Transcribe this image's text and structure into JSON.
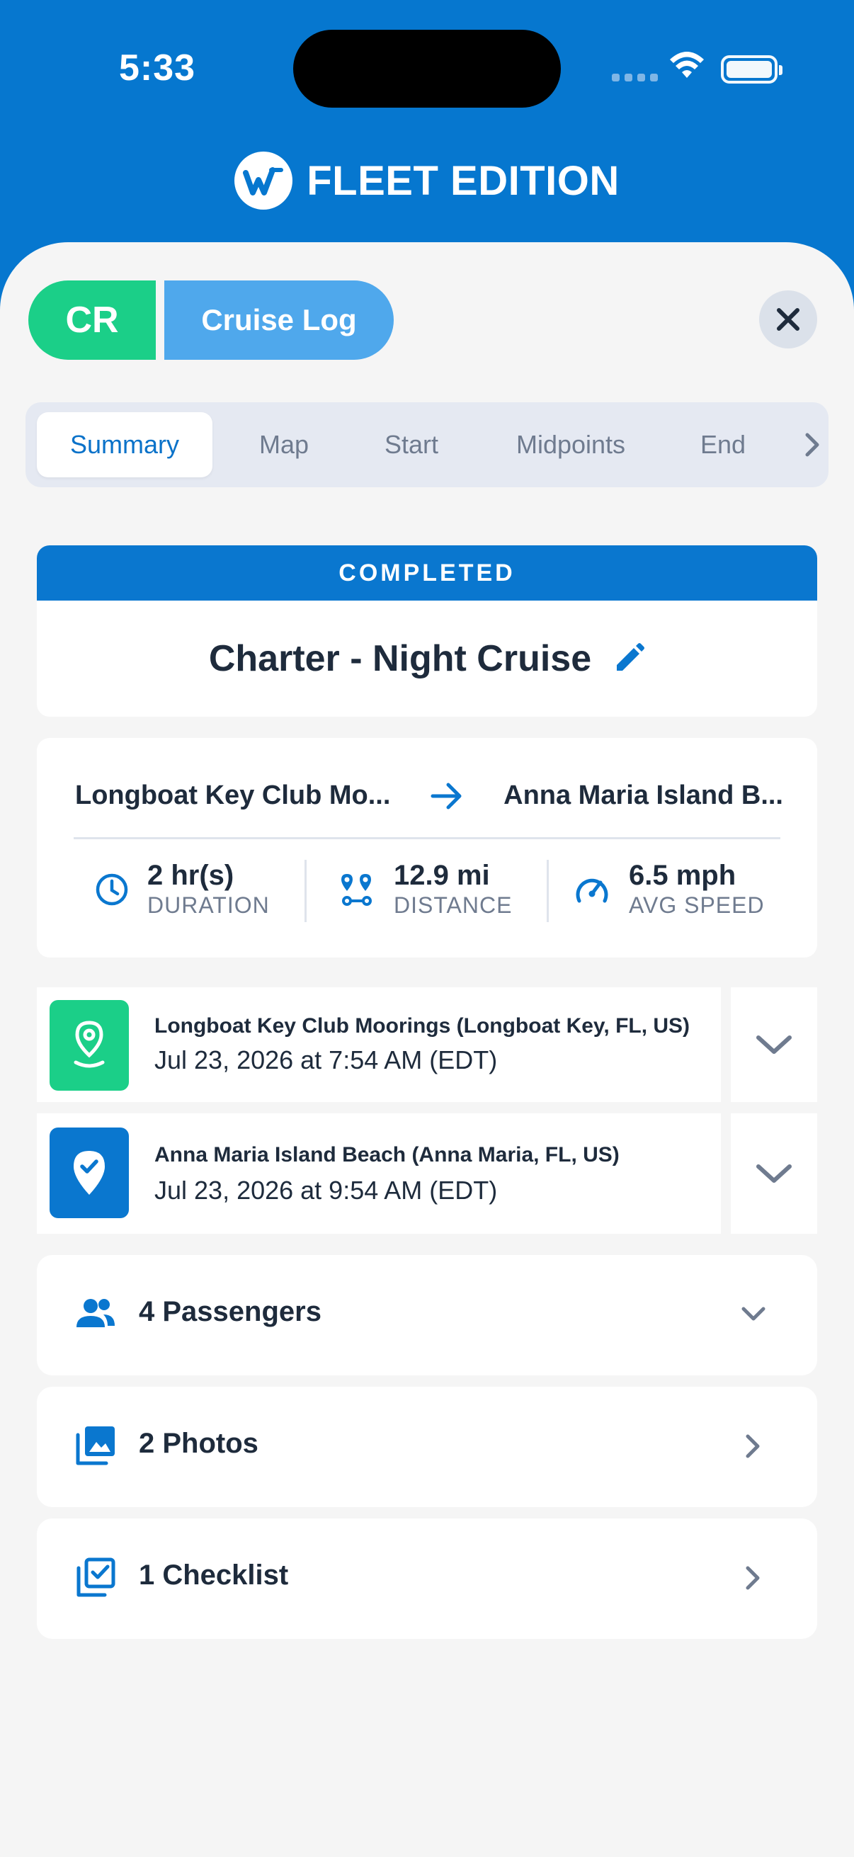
{
  "status_bar": {
    "time": "5:33"
  },
  "brand": {
    "title": "FLEET EDITION"
  },
  "header": {
    "badge": "CR",
    "label": "Cruise Log"
  },
  "tabs": [
    {
      "label": "Summary",
      "active": true
    },
    {
      "label": "Map",
      "active": false
    },
    {
      "label": "Start",
      "active": false
    },
    {
      "label": "Midpoints",
      "active": false
    },
    {
      "label": "End",
      "active": false
    }
  ],
  "trip": {
    "status": "COMPLETED",
    "title": "Charter - Night Cruise"
  },
  "route": {
    "from": "Longboat Key Club Mo...",
    "to": "Anna Maria Island B...",
    "stats": [
      {
        "value": "2 hr(s)",
        "label": "DURATION",
        "icon": "clock-icon"
      },
      {
        "value": "12.9 mi",
        "label": "DISTANCE",
        "icon": "route-pins-icon"
      },
      {
        "value": "6.5 mph",
        "label": "AVG SPEED",
        "icon": "speedometer-icon"
      }
    ]
  },
  "locations": [
    {
      "name": "Longboat Key Club Moorings (Longboat Key, FL, US)",
      "datetime": "Jul 23, 2026 at 7:54 AM (EDT)",
      "icon": "start-location-pin-icon",
      "color": "#1bcf88"
    },
    {
      "name": "Anna Maria Island Beach (Anna Maria, FL, US)",
      "datetime": "Jul 23, 2026 at 9:54 AM (EDT)",
      "icon": "end-location-check-pin-icon",
      "color": "#0a77cf"
    }
  ],
  "sections": [
    {
      "label": "4 Passengers",
      "icon": "people-icon",
      "chevron": "chevron-down-icon"
    },
    {
      "label": "2 Photos",
      "icon": "photos-icon",
      "chevron": "chevron-right-icon"
    },
    {
      "label": "1 Checklist",
      "icon": "checklist-icon",
      "chevron": "chevron-right-icon"
    }
  ],
  "colors": {
    "brand_blue": "#0677cf",
    "accent_green": "#1bcf88",
    "light_blue": "#4fa8ec"
  }
}
